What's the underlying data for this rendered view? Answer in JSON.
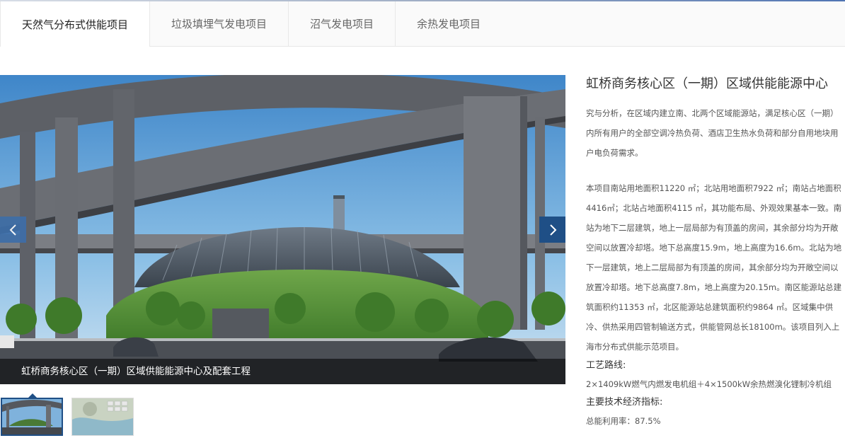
{
  "tabs": [
    {
      "label": "天然气分布式供能项目",
      "active": true
    },
    {
      "label": "垃圾填埋气发电项目",
      "active": false
    },
    {
      "label": "沼气发电项目",
      "active": false
    },
    {
      "label": "余热发电项目",
      "active": false
    }
  ],
  "slider": {
    "caption": "虹桥商务核心区（一期）区域供能能源中心及配套工程",
    "prev_icon": "chevron-left-icon",
    "next_icon": "chevron-right-icon"
  },
  "project": {
    "title": "虹桥商务核心区（一期）区域供能能源中心",
    "desc1_lines": [
      "究与分析，在区域内建立南、北两个区域能源站，满足核心区（一期）",
      "内所有用户的全部空调冷热负荷、酒店卫生热水负荷和部分自用地块用",
      "户电负荷需求。"
    ],
    "desc2_lines": [
      "本项目南站用地面积11220 ㎡；北站用地面积7922 ㎡；南站占地面积",
      "4416㎡；北站占地面积4115 ㎡，其功能布局、外观效果基本一致。南",
      "站为地下二层建筑，地上一层局部为有顶盖的房间，其余部分均为开敞",
      "空间以放置冷却塔。地下总高度15.9m，地上高度为16.6m。北站为地",
      "下一层建筑，地上二层局部为有顶盖的房间，其余部分均为开敞空间以",
      "放置冷却塔。地下总高度7.8m，地上高度为20.15m。南区能源站总建",
      "筑面积约11353 ㎡，北区能源站总建筑面积约9864 ㎡。区域集中供",
      "冷、供热采用四管制输送方式，供能管网总长18100m。该项目列入上",
      "海市分布式供能示范项目。"
    ],
    "route_label": "工艺路线:",
    "route_value": "2×1409kW燃气内燃发电机组＋4×1500kW余热燃溴化锂制冷机组",
    "indicator_label": "主要技术经济指标:",
    "indicator_value": "总能利用率：87.5%"
  }
}
